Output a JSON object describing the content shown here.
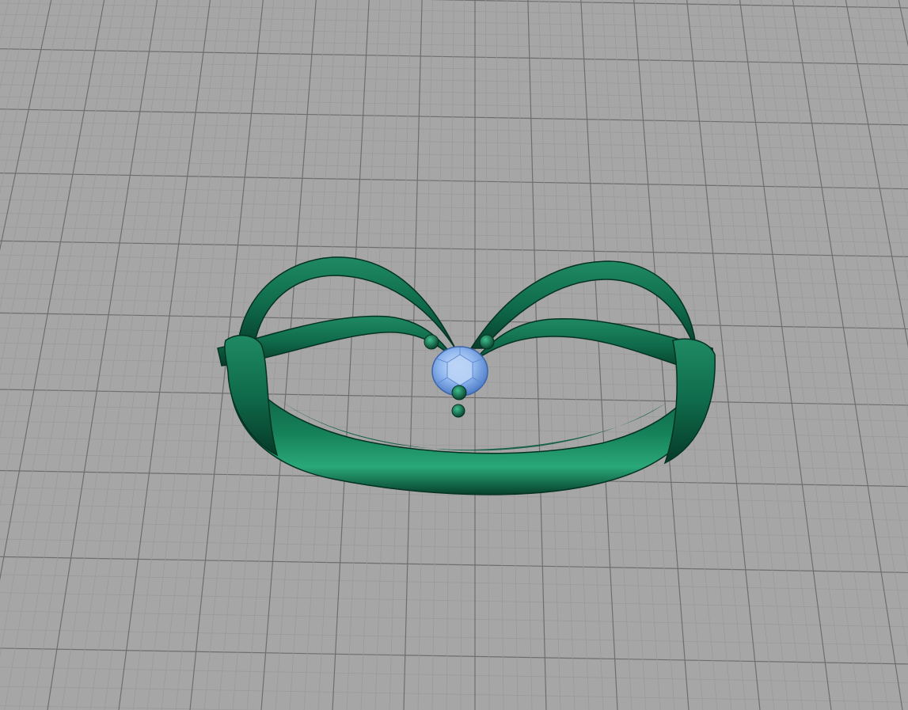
{
  "viewport": {
    "background_color": "#a6a6a6",
    "minor_grid_color": "#9a9a9a",
    "major_grid_color": "#6e6e6e",
    "grid_visible": true,
    "projection": "perspective"
  },
  "model": {
    "object": "ring",
    "material_color": "#0f6b4b",
    "material_highlight_color": "#3fbf8f",
    "material_shadow_color": "#063a28",
    "gem": {
      "cut": "round brilliant",
      "color": "#8fb6ee",
      "prongs": 4
    }
  }
}
